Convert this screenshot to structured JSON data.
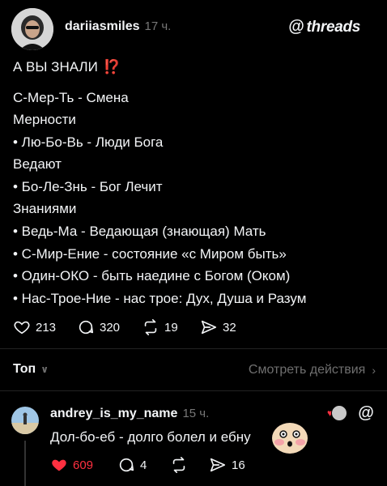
{
  "post": {
    "author": "dariiasmiles",
    "time": "17 ч.",
    "brand": "threads",
    "lines": [
      "А ВЫ ЗНАЛИ",
      "С-Мер-Ть -  Смена",
      "Мерности",
      "• Лю-Бо-Вь - Люди Бога",
      "Ведают",
      "• Бо-Ле-Знь - Бог Лечит",
      "Знаниями",
      "• Ведь-Ма - Ведающая (знающая) Мать",
      "• С-Мир-Ение - состояние «с Миром быть»",
      "• Один-ОКО - быть наедине с Богом (Оком)",
      "• Нас-Трое-Ние - нас трое: Дух, Душа и Разум"
    ],
    "emoji": "⁉️",
    "stats": {
      "likes": "213",
      "comments": "320",
      "reposts": "19",
      "shares": "32"
    }
  },
  "sort": {
    "label": "Топ",
    "view_activity": "Смотреть действия"
  },
  "reply": {
    "author": "andrey_is_my_name",
    "time": "15 ч.",
    "text": "Дол-бо-еб - долго болел и ебну",
    "stats": {
      "likes": "609",
      "comments": "4",
      "shares": "16"
    }
  },
  "colors": {
    "like": "#ff3040",
    "exclaim": "#ff3b30"
  }
}
